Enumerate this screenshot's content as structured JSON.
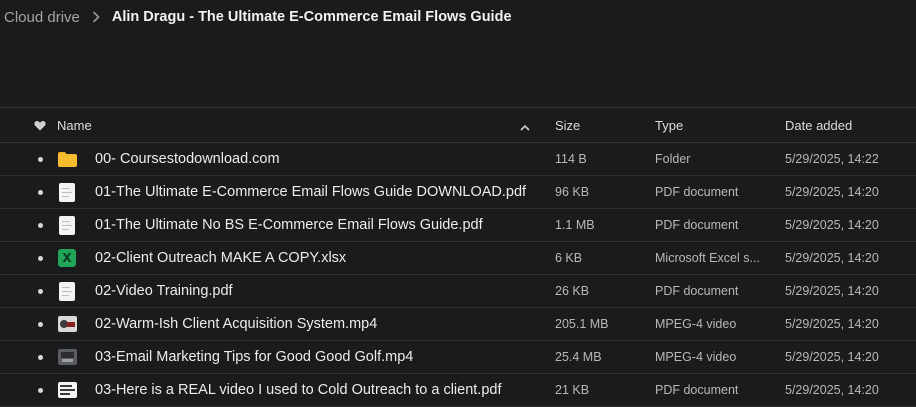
{
  "breadcrumb": {
    "root": "Cloud drive",
    "current": "Alin Dragu - The Ultimate E-Commerce Email Flows Guide"
  },
  "columns": {
    "name": "Name",
    "size": "Size",
    "type": "Type",
    "date": "Date added"
  },
  "files": [
    {
      "icon": "folder-icon",
      "name": "00- Coursestodownload.com",
      "size": "114 B",
      "type": "Folder",
      "date": "5/29/2025, 14:22"
    },
    {
      "icon": "document-icon",
      "name": "01-The Ultimate E-Commerce Email Flows Guide DOWNLOAD.pdf",
      "size": "96 KB",
      "type": "PDF document",
      "date": "5/29/2025, 14:20"
    },
    {
      "icon": "document-icon",
      "name": "01-The Ultimate No BS E-Commerce Email Flows Guide.pdf",
      "size": "1.1 MB",
      "type": "PDF document",
      "date": "5/29/2025, 14:20"
    },
    {
      "icon": "spreadsheet-icon",
      "name": "02-Client Outreach MAKE A COPY.xlsx",
      "size": "6 KB",
      "type": "Microsoft Excel s...",
      "date": "5/29/2025, 14:20"
    },
    {
      "icon": "document-icon",
      "name": "02-Video Training.pdf",
      "size": "26 KB",
      "type": "PDF document",
      "date": "5/29/2025, 14:20"
    },
    {
      "icon": "video-thumbnail-icon",
      "name": "02-Warm-Ish Client Acquisition System.mp4",
      "size": "205.1 MB",
      "type": "MPEG-4 video",
      "date": "5/29/2025, 14:20"
    },
    {
      "icon": "video-thumbnail-icon",
      "name": "03-Email Marketing Tips for Good Good Golf.mp4",
      "size": "25.4 MB",
      "type": "MPEG-4 video",
      "date": "5/29/2025, 14:20"
    },
    {
      "icon": "pdf-thumbnail-icon",
      "name": "03-Here is a REAL video I used to Cold Outreach to a client.pdf",
      "size": "21 KB",
      "type": "PDF document",
      "date": "5/29/2025, 14:20"
    }
  ],
  "colors": {
    "background": "#1a1b1c",
    "folder": "#f5bc2e",
    "excel": "#22a559"
  }
}
